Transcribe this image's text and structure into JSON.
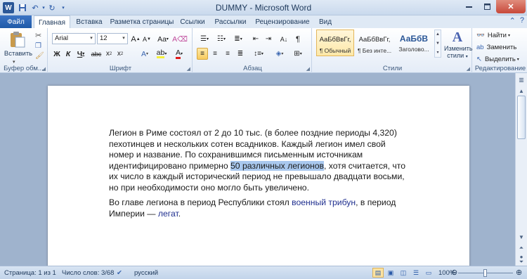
{
  "window": {
    "title": "DUMMY - Microsoft Word",
    "minimize_icon": "minimize-icon",
    "maximize_icon": "maximize-icon",
    "close_icon": "close-icon"
  },
  "tabs": {
    "file": "Файл",
    "items": [
      "Главная",
      "Вставка",
      "Разметка страницы",
      "Ссылки",
      "Рассылки",
      "Рецензирование",
      "Вид"
    ],
    "active": "Главная"
  },
  "ribbon": {
    "clipboard": {
      "paste_label": "Вставить",
      "group_label": "Буфер обм..."
    },
    "font": {
      "font_name": "Arial",
      "font_size": "12",
      "group_label": "Шрифт"
    },
    "paragraph": {
      "group_label": "Абзац"
    },
    "styles": {
      "group_label": "Стили",
      "items": [
        {
          "sample": "АаБбВвГг,",
          "name": "¶ Обычный",
          "selected": true
        },
        {
          "sample": "АаБбВвГг,",
          "name": "¶ Без инте...",
          "selected": false
        },
        {
          "sample": "АаБбВ",
          "name": "Заголово...",
          "selected": false
        }
      ],
      "change_styles_line1": "Изменить",
      "change_styles_line2": "стили"
    },
    "editing": {
      "group_label": "Редактирование",
      "find": "Найти",
      "replace": "Заменить",
      "select": "Выделить"
    }
  },
  "document": {
    "p1_before": "Легион в Риме состоял от 2 до 10 тыс. (в более поздние периоды 4,320) пехотинцев и нескольких сотен всадников. Каждый легион имел свой номер и название. По сохранившимся письменным источникам идентифицировано примерно ",
    "p1_highlight": "50 различных легионов",
    "p1_after": ", хотя считается, что их число в каждый исторический период не превышало двадцати восьми, но при необходимости оно могло быть увеличено.",
    "p2_before": "Во главе легиона в период Республики стоял ",
    "p2_link1": "военный трибун",
    "p2_mid": ", в период Империи — ",
    "p2_link2": "легат",
    "p2_end": "."
  },
  "statusbar": {
    "page": "Страница: 1 из 1",
    "words": "Число слов: 3/68",
    "language": "русский",
    "zoom": "100%",
    "zoom_value": 100
  }
}
